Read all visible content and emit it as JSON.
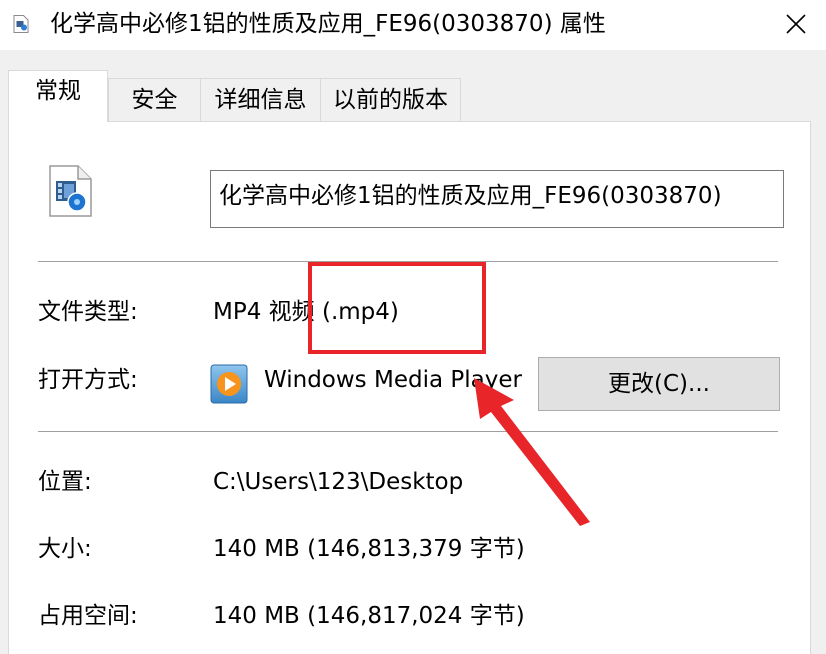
{
  "window": {
    "title": "化学高中必修1铝的性质及应用_FE96(0303870) 属性",
    "close_glyph": "✕"
  },
  "tabs": [
    {
      "label": "常规",
      "active": true
    },
    {
      "label": "安全",
      "active": false
    },
    {
      "label": "详细信息",
      "active": false
    },
    {
      "label": "以前的版本",
      "active": false
    }
  ],
  "general": {
    "file_name": "化学高中必修1铝的性质及应用_FE96(0303870)",
    "file_type_label": "文件类型:",
    "file_type_value": "MP4 视频 (.mp4)",
    "open_with_label": "打开方式:",
    "open_with_app": "Windows Media Player",
    "change_button": "更改(C)...",
    "location_label": "位置:",
    "location_value": "C:\\Users\\123\\Desktop",
    "size_label": "大小:",
    "size_value": "140 MB (146,813,379 字节)",
    "disk_size_label": "占用空间:",
    "disk_size_value": "140 MB (146,817,024 字节)"
  },
  "annotation": {
    "color": "#e8262a"
  },
  "icons": {
    "file": "video-file-icon",
    "app": "windows-media-player-icon",
    "close": "close-icon"
  }
}
